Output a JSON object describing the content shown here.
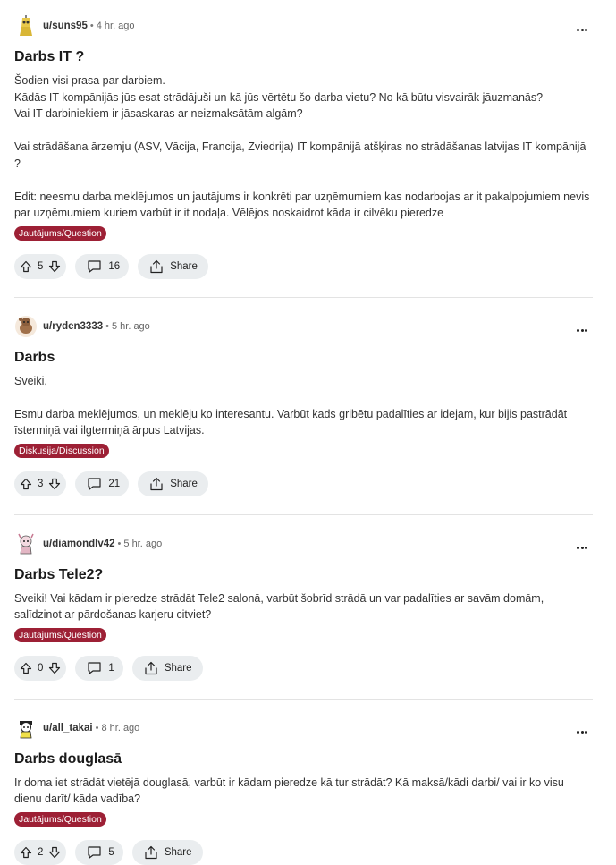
{
  "colors": {
    "flair_bg": "#9d2035",
    "pill_bg": "#eaedef"
  },
  "share_label": "Share",
  "posts": [
    {
      "user": "u/suns95",
      "time": "4 hr. ago",
      "title": "Darbs IT ?",
      "body": "Šodien visi prasa par darbiem.\nKādās IT kompānijās jūs esat strādājuši un kā jūs vērtētu šo darba vietu? No kā būtu visvairāk jāuzmanās?\nVai IT darbiniekiem ir jāsaskaras ar neizmaksātām algām?\n\nVai strādāšana ārzemju (ASV, Vācija, Francija, Zviedrija) IT kompānijā atšķiras no strādāšanas latvijas IT kompānijā ?\n\nEdit: neesmu darba meklējumos un jautājums ir konkrēti par uzņēmumiem kas nodarbojas ar it pakalpojumiem nevis par uzņēmumiem kuriem varbūt ir it nodaļa. Vēlējos noskaidrot kāda ir cilvēku pieredze",
      "flair": "Jautājums/Question",
      "votes": "5",
      "comments": "16",
      "avatar": "yellow-robot-avatar"
    },
    {
      "user": "u/ryden3333",
      "time": "5 hr. ago",
      "title": "Darbs",
      "body": "Sveiki,\n\nEsmu darba meklējumos, un meklēju ko interesantu. Varbūt kads gribētu padalīties ar idejam, kur bijis pastrādāt īstermiņā vai ilgtermiņā ārpus Latvijas.",
      "flair": "Diskusija/Discussion",
      "votes": "3",
      "comments": "21",
      "avatar": "brown-snoo-avatar"
    },
    {
      "user": "u/diamondlv42",
      "time": "5 hr. ago",
      "title": "Darbs Tele2?",
      "body": "Sveiki! Vai kādam ir pieredze strādāt Tele2 salonā, varbūt šobrīd strādā un var padalīties ar savām domām, salīdzinot ar pārdošanas karjeru citviet?",
      "flair": "Jautājums/Question",
      "votes": "0",
      "comments": "1",
      "avatar": "pink-snoo-avatar"
    },
    {
      "user": "u/all_takai",
      "time": "8 hr. ago",
      "title": "Darbs douglasā",
      "body": "Ir doma iet strādāt vietējā douglasā, varbūt ir kādam pieredze kā tur strādāt? Kā maksā/kādi darbi/ vai ir ko visu dienu darīt/ kāda vadība?",
      "flair": "Jautājums/Question",
      "votes": "2",
      "comments": "5",
      "avatar": "black-white-snoo-avatar"
    }
  ]
}
